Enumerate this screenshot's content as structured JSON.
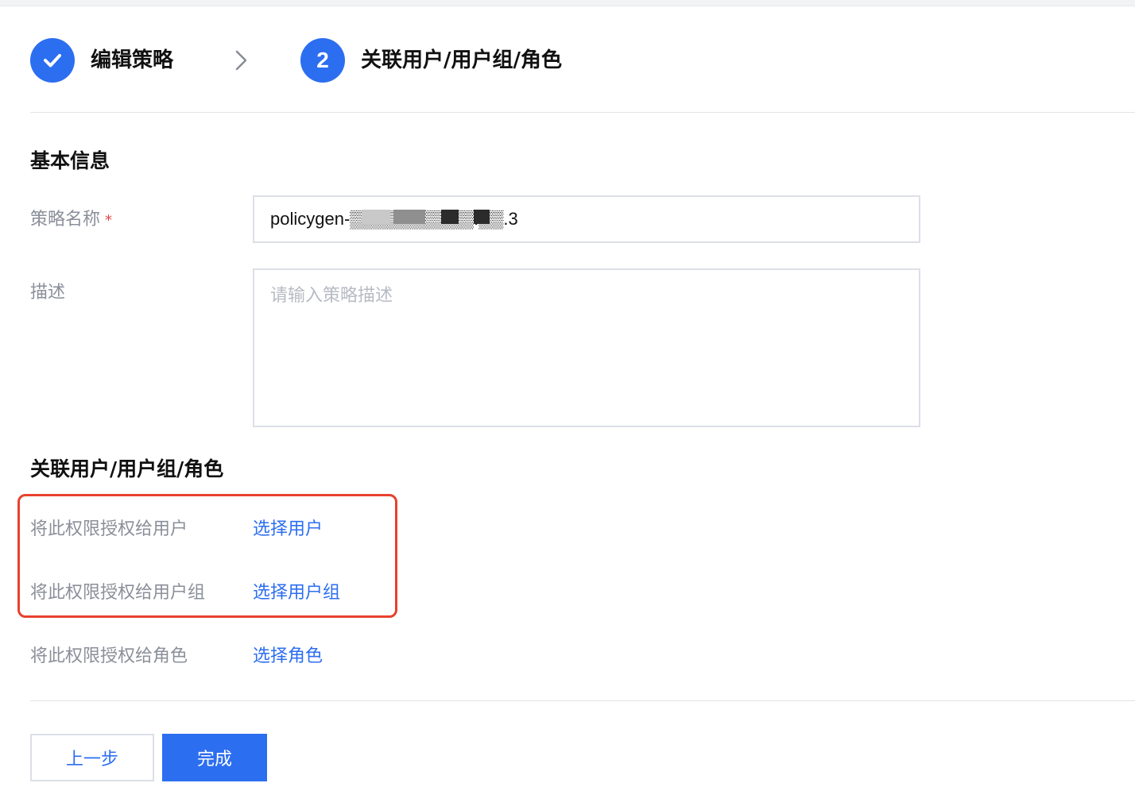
{
  "steps": [
    {
      "label": "编辑策略",
      "state": "done"
    },
    {
      "label": "关联用户/用户组/角色",
      "number": "2",
      "state": "active"
    }
  ],
  "basic_info": {
    "title": "基本信息",
    "name_label": "策略名称",
    "required_mark": "*",
    "name_value": "policygen-▒▒▒▒▒▒▒▒▒▒.▒▒.3",
    "desc_label": "描述",
    "desc_placeholder": "请输入策略描述"
  },
  "association": {
    "title": "关联用户/用户组/角色",
    "rows": [
      {
        "label": "将此权限授权给用户",
        "link": "选择用户"
      },
      {
        "label": "将此权限授权给用户组",
        "link": "选择用户组"
      },
      {
        "label": "将此权限授权给角色",
        "link": "选择角色"
      }
    ]
  },
  "buttons": {
    "prev": "上一步",
    "done": "完成"
  },
  "colors": {
    "primary": "#2c6ef0",
    "highlight": "#e8412f",
    "label_gray": "#8a8f99",
    "required": "#e54545"
  }
}
